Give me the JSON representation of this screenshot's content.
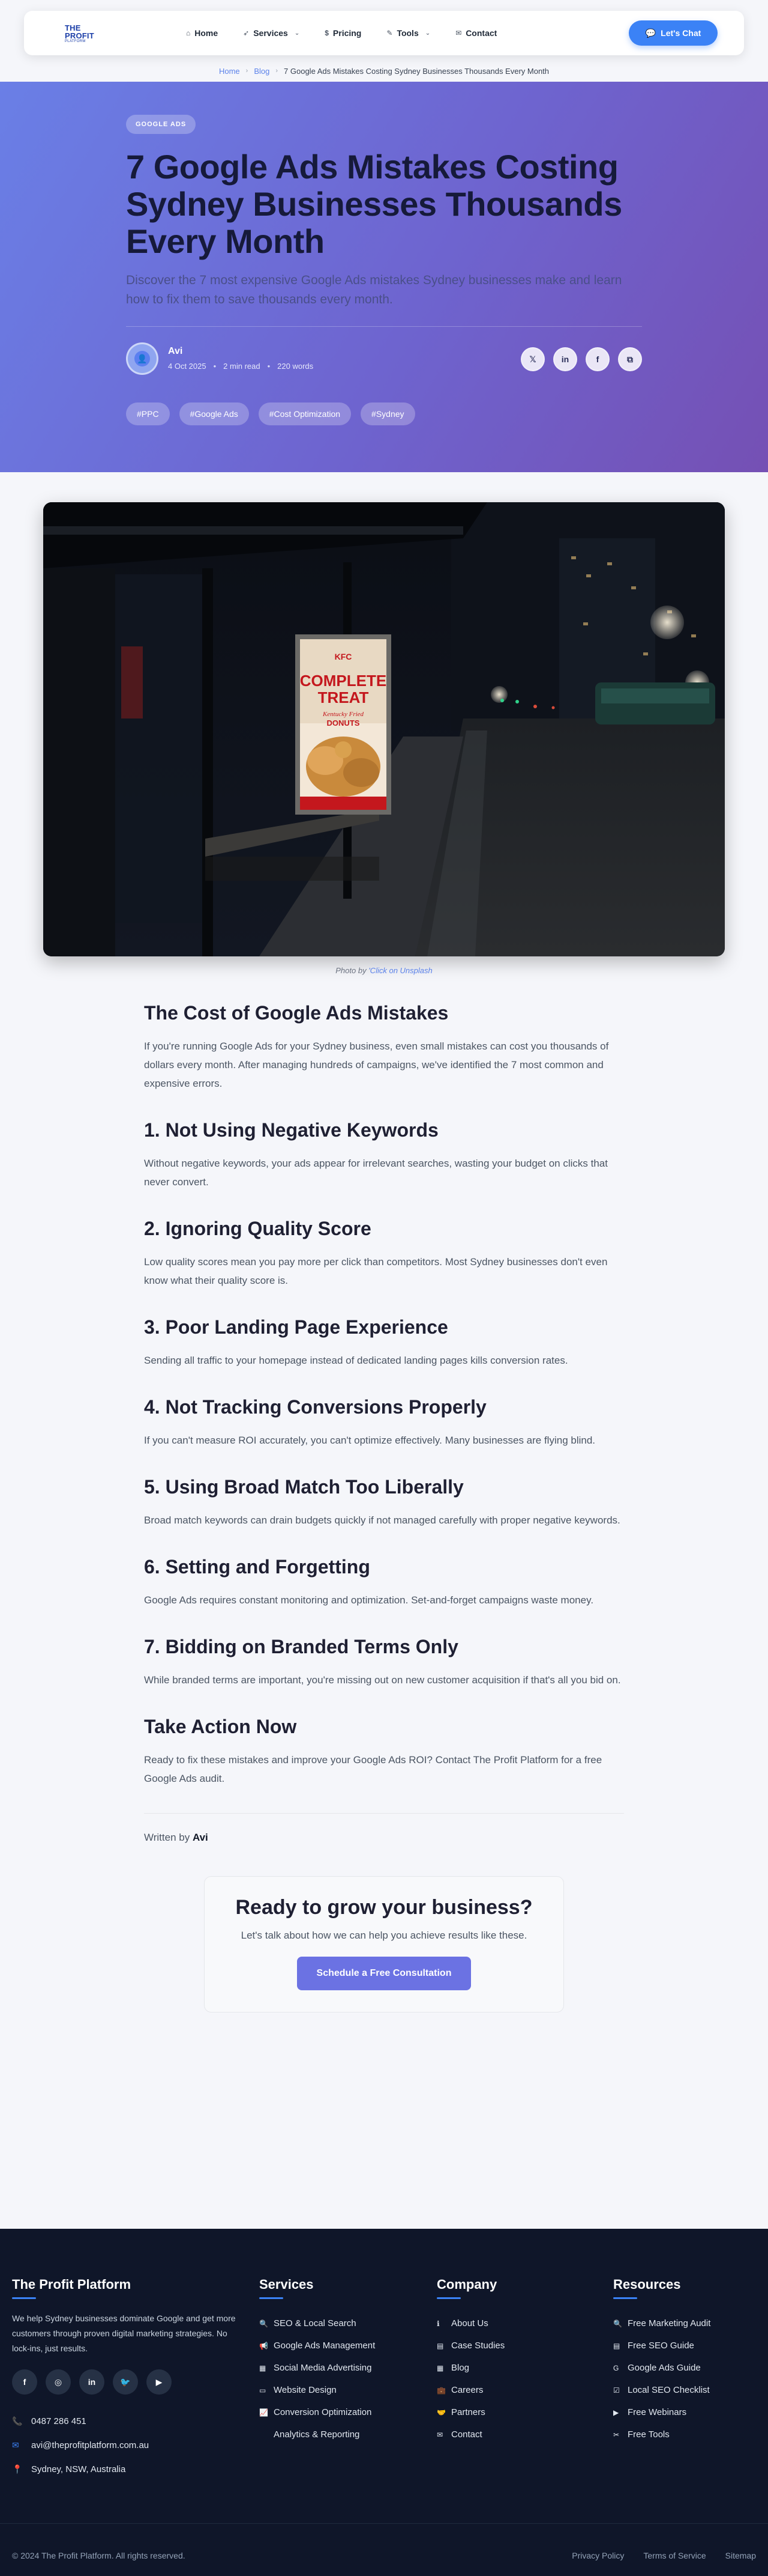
{
  "brand": {
    "logo_line1": "THE",
    "logo_line2": "PROFIT",
    "logo_line3": "PLATFORM"
  },
  "nav": [
    {
      "label": "Home",
      "icon": "home-icon",
      "glyph": "⌂"
    },
    {
      "label": "Services",
      "icon": "rocket-icon",
      "glyph": "➶",
      "dropdown": true
    },
    {
      "label": "Pricing",
      "icon": "dollar-icon",
      "glyph": "$"
    },
    {
      "label": "Tools",
      "icon": "wrench-icon",
      "glyph": "✎",
      "dropdown": true
    },
    {
      "label": "Contact",
      "icon": "mail-icon",
      "glyph": "✉"
    }
  ],
  "cta_chat": "Let's Chat",
  "breadcrumb": {
    "home": "Home",
    "blog": "Blog",
    "current": "7 Google Ads Mistakes Costing Sydney Businesses Thousands Every Month"
  },
  "hero": {
    "category": "GOOGLE ADS",
    "title": "7 Google Ads Mistakes Costing Sydney Businesses Thousands Every Month",
    "description": "Discover the 7 most expensive Google Ads mistakes Sydney businesses make and learn how to fix them to save thousands every month.",
    "author": "Avi",
    "date": "4 Oct 2025",
    "read_time": "2 min read",
    "words": "220 words",
    "share": [
      {
        "name": "x-share-button",
        "glyph": "𝕏"
      },
      {
        "name": "linkedin-share-button",
        "glyph": "in"
      },
      {
        "name": "facebook-share-button",
        "glyph": "f"
      },
      {
        "name": "copy-link-button",
        "glyph": "⧉"
      }
    ],
    "tags": [
      "#PPC",
      "#Google Ads",
      "#Cost Optimization",
      "#Sydney"
    ]
  },
  "photo": {
    "sign_line1": "COMPLETE",
    "sign_line2": "TREAT",
    "sign_line3": "Kentucky Fried",
    "sign_line4": "DONUTS",
    "sign_brand": "KFC",
    "credit_prefix": "Photo by",
    "credit_link": "'Click on Unsplash"
  },
  "article": {
    "sections": [
      {
        "heading": "The Cost of Google Ads Mistakes",
        "body": "If you're running Google Ads for your Sydney business, even small mistakes can cost you thousands of dollars every month. After managing hundreds of campaigns, we've identified the 7 most common and expensive errors."
      },
      {
        "heading": "1. Not Using Negative Keywords",
        "body": "Without negative keywords, your ads appear for irrelevant searches, wasting your budget on clicks that never convert."
      },
      {
        "heading": "2. Ignoring Quality Score",
        "body": "Low quality scores mean you pay more per click than competitors. Most Sydney businesses don't even know what their quality score is."
      },
      {
        "heading": "3. Poor Landing Page Experience",
        "body": "Sending all traffic to your homepage instead of dedicated landing pages kills conversion rates."
      },
      {
        "heading": "4. Not Tracking Conversions Properly",
        "body": "If you can't measure ROI accurately, you can't optimize effectively. Many businesses are flying blind."
      },
      {
        "heading": "5. Using Broad Match Too Liberally",
        "body": "Broad match keywords can drain budgets quickly if not managed carefully with proper negative keywords."
      },
      {
        "heading": "6. Setting and Forgetting",
        "body": "Google Ads requires constant monitoring and optimization. Set-and-forget campaigns waste money."
      },
      {
        "heading": "7. Bidding on Branded Terms Only",
        "body": "While branded terms are important, you're missing out on new customer acquisition if that's all you bid on."
      },
      {
        "heading": "Take Action Now",
        "body": "Ready to fix these mistakes and improve your Google Ads ROI? Contact The Profit Platform for a free Google Ads audit."
      }
    ],
    "written_by_prefix": "Written by",
    "written_by": "Avi"
  },
  "cta": {
    "title": "Ready to grow your business?",
    "text": "Let's talk about how we can help you achieve results like these.",
    "button": "Schedule a Free Consultation"
  },
  "footer": {
    "brand_title": "The Profit Platform",
    "about": "We help Sydney businesses dominate Google and get more customers through proven digital marketing strategies. No lock-ins, just results.",
    "social": [
      {
        "name": "facebook-icon",
        "glyph": "f"
      },
      {
        "name": "instagram-icon",
        "glyph": "◎"
      },
      {
        "name": "linkedin-icon",
        "glyph": "in"
      },
      {
        "name": "twitter-icon",
        "glyph": "🐦"
      },
      {
        "name": "youtube-icon",
        "glyph": "▶"
      }
    ],
    "phone": "0487 286 451",
    "email": "avi@theprofitplatform.com.au",
    "location": "Sydney, NSW, Australia",
    "services_title": "Services",
    "services": [
      {
        "label": "SEO & Local Search",
        "glyph": "🔍"
      },
      {
        "label": "Google Ads Management",
        "glyph": "📢"
      },
      {
        "label": "Social Media Advertising",
        "glyph": "▦"
      },
      {
        "label": "Website Design",
        "glyph": "▭"
      },
      {
        "label": "Conversion Optimization",
        "glyph": "📈"
      },
      {
        "label": "Analytics & Reporting",
        "glyph": ""
      }
    ],
    "company_title": "Company",
    "company": [
      {
        "label": "About Us",
        "glyph": "ℹ"
      },
      {
        "label": "Case Studies",
        "glyph": "▤"
      },
      {
        "label": "Blog",
        "glyph": "▦"
      },
      {
        "label": "Careers",
        "glyph": "💼"
      },
      {
        "label": "Partners",
        "glyph": "🤝"
      },
      {
        "label": "Contact",
        "glyph": "✉"
      }
    ],
    "resources_title": "Resources",
    "resources": [
      {
        "label": "Free Marketing Audit",
        "glyph": "🔍"
      },
      {
        "label": "Free SEO Guide",
        "glyph": "▤"
      },
      {
        "label": "Google Ads Guide",
        "glyph": "G"
      },
      {
        "label": "Local SEO Checklist",
        "glyph": "☑"
      },
      {
        "label": "Free Webinars",
        "glyph": "▶"
      },
      {
        "label": "Free Tools",
        "glyph": "✂"
      }
    ],
    "copyright": "© 2024 The Profit Platform. All rights reserved.",
    "legal": [
      "Privacy Policy",
      "Terms of Service",
      "Sitemap"
    ]
  },
  "colors": {
    "accent": "#3b82f6",
    "hero_start": "#6a7fe6",
    "hero_end": "#7550b4",
    "footer_bg": "#0f1629",
    "cta_button": "#6b72e3"
  }
}
